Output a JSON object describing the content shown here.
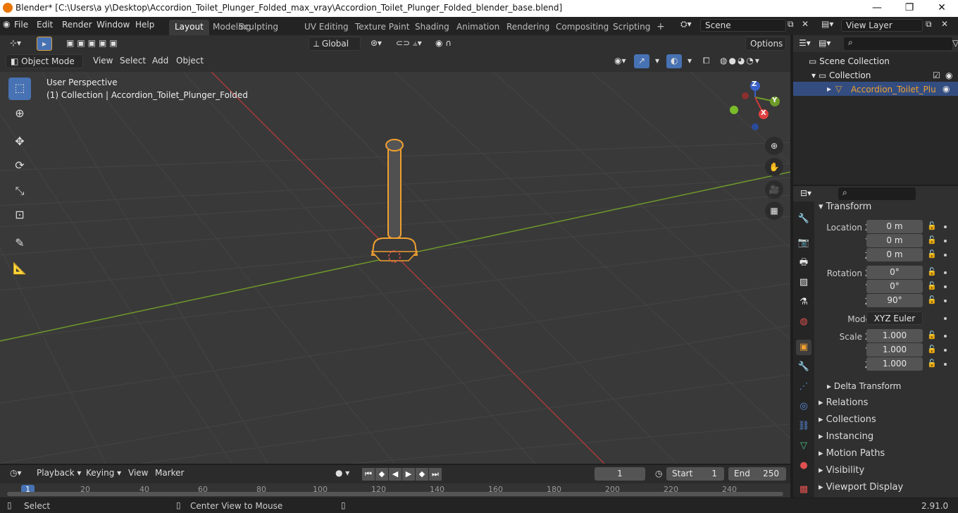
{
  "window": {
    "title": "Blender* [C:\\Users\\a y\\Desktop\\Accordion_Toilet_Plunger_Folded_max_vray\\Accordion_Toilet_Plunger_Folded_blender_base.blend]",
    "minimize": "—",
    "maximize": "❐",
    "close": "✕"
  },
  "menu": [
    "File",
    "Edit",
    "Render",
    "Window",
    "Help"
  ],
  "workspaces": [
    "Layout",
    "Modeling",
    "Sculpting",
    "UV Editing",
    "Texture Paint",
    "Shading",
    "Animation",
    "Rendering",
    "Compositing",
    "Scripting"
  ],
  "active_workspace": "Layout",
  "add_workspace": "+",
  "scene": {
    "label": "Scene"
  },
  "view_layer": {
    "label": "View Layer"
  },
  "viewport_header": {
    "transform_orientation": "Global",
    "options": "Options",
    "mode": "Object Mode",
    "menus": [
      "View",
      "Select",
      "Add",
      "Object"
    ]
  },
  "overlay_text": {
    "line1": "User Perspective",
    "line2": "(1) Collection | Accordion_Toilet_Plunger_Folded"
  },
  "gizmo": {
    "x": "X",
    "y": "Y",
    "z": "Z"
  },
  "outliner": {
    "scene_collection": "Scene Collection",
    "collection": "Collection",
    "object": "Accordion_Toilet_Plu"
  },
  "properties": {
    "section": "Transform",
    "location": {
      "label": "Location X",
      "x": "0 m",
      "y": "0 m",
      "z": "0 m"
    },
    "rotation": {
      "label": "Rotation X",
      "x": "0°",
      "y": "0°",
      "z": "90°"
    },
    "mode": {
      "label": "Mode",
      "value": "XYZ Euler"
    },
    "scale": {
      "label": "Scale X",
      "x": "1.000",
      "y": "1.000",
      "z": "1.000"
    },
    "axis_y": "Y",
    "axis_z": "Z",
    "delta": "Delta Transform",
    "panels": [
      "Relations",
      "Collections",
      "Instancing",
      "Motion Paths",
      "Visibility",
      "Viewport Display"
    ]
  },
  "timeline": {
    "menus": [
      "Playback",
      "Keying",
      "View",
      "Marker"
    ],
    "current_frame": "1",
    "start_label": "Start",
    "start": "1",
    "end_label": "End",
    "end": "250",
    "ticks": [
      "1",
      "20",
      "40",
      "60",
      "80",
      "100",
      "120",
      "140",
      "160",
      "180",
      "200",
      "220",
      "240"
    ]
  },
  "status": {
    "select": "Select",
    "center": "Center View to Mouse",
    "version": "2.91.0"
  },
  "colors": {
    "accent": "#4772b3",
    "selection": "#f0a030",
    "x_axis": "#a33c3c",
    "y_axis": "#6e9a2a"
  }
}
